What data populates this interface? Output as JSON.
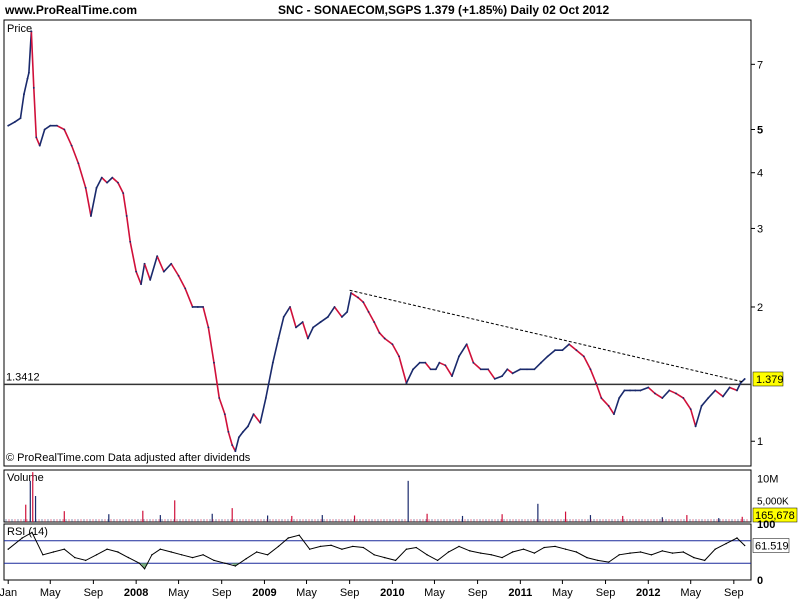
{
  "header": {
    "site": "www.ProRealTime.com",
    "title": "SNC - SONAECOM,SGPS    1.379 (+1.85%)    Daily  02 Oct 2012"
  },
  "chart_data": [
    {
      "type": "line",
      "title": "",
      "ylabel": "Price",
      "scale": "log",
      "ylim": [
        0.88,
        8.8
      ],
      "y_ticks": [
        "1",
        "2",
        "3",
        "4",
        "5",
        "7"
      ],
      "y_ticks_bold": [
        "5"
      ],
      "horizontal_line": {
        "value": 1.3412,
        "label": "1.3412"
      },
      "last_value_label": "1.379",
      "trendline": {
        "from": {
          "date": "2009-09-01",
          "value": 2.18
        },
        "to": {
          "date": "2012-09-25",
          "value": 1.36
        }
      },
      "colors": {
        "up": "#1a2a6c",
        "down": "#d0103a",
        "last_badge": "#ffff00",
        "line": "#000000",
        "trend": "#000000"
      },
      "series": [
        {
          "x": [
            "2007-01-01",
            "2007-01-20",
            "2007-02-05",
            "2007-02-15",
            "2007-02-25",
            "2007-03-01",
            "2007-03-08",
            "2007-03-15",
            "2007-03-22",
            "2007-04-01",
            "2007-04-15",
            "2007-05-01",
            "2007-05-20",
            "2007-06-10",
            "2007-07-01",
            "2007-07-20",
            "2007-08-10",
            "2007-08-25",
            "2007-09-10",
            "2007-09-25",
            "2007-10-10",
            "2007-10-25",
            "2007-11-10",
            "2007-11-25",
            "2007-12-05",
            "2007-12-15",
            "2008-01-01",
            "2008-01-15",
            "2008-01-25",
            "2008-02-10",
            "2008-03-01",
            "2008-03-20",
            "2008-04-10",
            "2008-05-01",
            "2008-05-20",
            "2008-06-10",
            "2008-06-25",
            "2008-07-10",
            "2008-07-25",
            "2008-08-10",
            "2008-08-25",
            "2008-09-10",
            "2008-09-20",
            "2008-10-01",
            "2008-10-10",
            "2008-10-20",
            "2008-11-01",
            "2008-11-15",
            "2008-12-01",
            "2008-12-20",
            "2009-01-05",
            "2009-01-25",
            "2009-02-10",
            "2009-02-25",
            "2009-03-15",
            "2009-04-01",
            "2009-04-20",
            "2009-05-05",
            "2009-05-20",
            "2009-06-10",
            "2009-07-01",
            "2009-07-20",
            "2009-08-10",
            "2009-08-25",
            "2009-09-05",
            "2009-09-25",
            "2009-10-10",
            "2009-10-25",
            "2009-11-10",
            "2009-11-25",
            "2009-12-10",
            "2010-01-01",
            "2010-01-20",
            "2010-02-10",
            "2010-03-01",
            "2010-03-20",
            "2010-04-05",
            "2010-04-20",
            "2010-05-05",
            "2010-05-15",
            "2010-06-01",
            "2010-06-20",
            "2010-07-10",
            "2010-08-01",
            "2010-08-20",
            "2010-09-10",
            "2010-10-01",
            "2010-10-20",
            "2010-11-10",
            "2010-11-25",
            "2010-12-10",
            "2011-01-01",
            "2011-01-20",
            "2011-02-10",
            "2011-03-01",
            "2011-03-20",
            "2011-04-10",
            "2011-05-01",
            "2011-05-20",
            "2011-06-10",
            "2011-07-01",
            "2011-07-20",
            "2011-08-05",
            "2011-08-20",
            "2011-09-10",
            "2011-09-25",
            "2011-10-10",
            "2011-10-25",
            "2011-11-10",
            "2011-11-25",
            "2011-12-10",
            "2012-01-01",
            "2012-01-20",
            "2012-02-10",
            "2012-03-01",
            "2012-03-20",
            "2012-04-10",
            "2012-05-01",
            "2012-05-15",
            "2012-06-01",
            "2012-06-20",
            "2012-07-10",
            "2012-08-01",
            "2012-08-20",
            "2012-09-10",
            "2012-09-20",
            "2012-10-02"
          ],
          "values": [
            5.1,
            5.2,
            5.3,
            6.0,
            6.5,
            6.7,
            8.3,
            6.2,
            4.8,
            4.6,
            5.0,
            5.1,
            5.1,
            5.0,
            4.6,
            4.2,
            3.7,
            3.2,
            3.7,
            3.9,
            3.8,
            3.9,
            3.8,
            3.6,
            3.2,
            2.8,
            2.4,
            2.25,
            2.5,
            2.3,
            2.6,
            2.4,
            2.5,
            2.35,
            2.2,
            2.0,
            2.0,
            2.0,
            1.8,
            1.5,
            1.25,
            1.15,
            1.05,
            0.98,
            0.95,
            1.02,
            1.05,
            1.08,
            1.15,
            1.1,
            1.25,
            1.5,
            1.7,
            1.9,
            2.0,
            1.8,
            1.85,
            1.7,
            1.8,
            1.85,
            1.9,
            2.0,
            1.9,
            1.95,
            2.15,
            2.1,
            2.05,
            1.95,
            1.85,
            1.75,
            1.7,
            1.65,
            1.55,
            1.35,
            1.45,
            1.5,
            1.5,
            1.45,
            1.45,
            1.5,
            1.48,
            1.4,
            1.55,
            1.65,
            1.5,
            1.45,
            1.45,
            1.38,
            1.4,
            1.45,
            1.42,
            1.45,
            1.45,
            1.45,
            1.5,
            1.55,
            1.6,
            1.6,
            1.65,
            1.6,
            1.55,
            1.45,
            1.35,
            1.25,
            1.2,
            1.15,
            1.25,
            1.3,
            1.3,
            1.3,
            1.3,
            1.32,
            1.28,
            1.25,
            1.3,
            1.28,
            1.25,
            1.18,
            1.08,
            1.2,
            1.25,
            1.3,
            1.26,
            1.32,
            1.3,
            1.35,
            1.379
          ]
        }
      ],
      "x_ticks": [
        {
          "date": "2007-01-01",
          "label": "Jan",
          "bold": false
        },
        {
          "date": "2007-05-01",
          "label": "May",
          "bold": false
        },
        {
          "date": "2007-09-01",
          "label": "Sep",
          "bold": false
        },
        {
          "date": "2008-01-01",
          "label": "2008",
          "bold": true
        },
        {
          "date": "2008-05-01",
          "label": "May",
          "bold": false
        },
        {
          "date": "2008-09-01",
          "label": "Sep",
          "bold": false
        },
        {
          "date": "2009-01-01",
          "label": "2009",
          "bold": true
        },
        {
          "date": "2009-05-01",
          "label": "May",
          "bold": false
        },
        {
          "date": "2009-09-01",
          "label": "Sep",
          "bold": false
        },
        {
          "date": "2010-01-01",
          "label": "2010",
          "bold": true
        },
        {
          "date": "2010-05-01",
          "label": "May",
          "bold": false
        },
        {
          "date": "2010-09-01",
          "label": "Sep",
          "bold": false
        },
        {
          "date": "2011-01-01",
          "label": "2011",
          "bold": true
        },
        {
          "date": "2011-05-01",
          "label": "May",
          "bold": false
        },
        {
          "date": "2011-09-01",
          "label": "Sep",
          "bold": false
        },
        {
          "date": "2012-01-01",
          "label": "2012",
          "bold": true
        },
        {
          "date": "2012-05-01",
          "label": "May",
          "bold": false
        },
        {
          "date": "2012-09-01",
          "label": "Sep",
          "bold": false
        }
      ],
      "x_range": [
        "2006-12-20",
        "2012-10-20"
      ],
      "footnote": "© ProRealTime.com  Data adjusted after dividends"
    },
    {
      "type": "bar",
      "ylabel": "Volume",
      "y_ticks": [
        "10M",
        "5,000K"
      ],
      "ylim": [
        0,
        12000000
      ],
      "last_value_label": "165,678",
      "series": [
        {
          "x": [
            "2007-02-20",
            "2007-03-05",
            "2007-03-12",
            "2007-03-20",
            "2007-06-10",
            "2007-10-15",
            "2008-01-20",
            "2008-03-10",
            "2008-04-20",
            "2008-08-05",
            "2008-10-01",
            "2009-01-10",
            "2009-03-20",
            "2009-06-15",
            "2009-09-15",
            "2010-02-15",
            "2010-04-10",
            "2010-07-20",
            "2010-11-10",
            "2011-02-20",
            "2011-05-10",
            "2011-07-20",
            "2011-10-20",
            "2012-02-10",
            "2012-04-20",
            "2012-07-20",
            "2012-09-25"
          ],
          "values": [
            4000000,
            9500000,
            11500000,
            6000000,
            2500000,
            1800000,
            2600000,
            1600000,
            5000000,
            1900000,
            3200000,
            1500000,
            1400000,
            1600000,
            1500000,
            9500000,
            1900000,
            1400000,
            1800000,
            4200000,
            2400000,
            1600000,
            1400000,
            1100000,
            1600000,
            900000,
            1200000
          ]
        }
      ],
      "colors": {
        "up": "#1a2a6c",
        "down": "#d0103a",
        "last_badge": "#ffff00"
      }
    },
    {
      "type": "line",
      "ylabel": "RSI (14)",
      "ylim": [
        0,
        100
      ],
      "y_ticks": [
        "100",
        "0"
      ],
      "bands": [
        30,
        70
      ],
      "last_value_label": "61.519",
      "series": [
        {
          "x": [
            "2007-01-01",
            "2007-02-10",
            "2007-03-10",
            "2007-04-10",
            "2007-05-10",
            "2007-06-10",
            "2007-07-10",
            "2007-08-10",
            "2007-09-10",
            "2007-10-10",
            "2007-11-10",
            "2007-12-10",
            "2008-01-10",
            "2008-01-25",
            "2008-02-15",
            "2008-03-10",
            "2008-04-10",
            "2008-05-10",
            "2008-06-10",
            "2008-07-10",
            "2008-08-10",
            "2008-09-10",
            "2008-10-10",
            "2008-11-10",
            "2008-12-10",
            "2009-01-10",
            "2009-02-10",
            "2009-03-10",
            "2009-04-10",
            "2009-05-10",
            "2009-06-10",
            "2009-07-10",
            "2009-08-10",
            "2009-09-10",
            "2009-10-10",
            "2009-11-10",
            "2009-12-10",
            "2010-01-10",
            "2010-02-10",
            "2010-03-10",
            "2010-04-10",
            "2010-05-10",
            "2010-06-10",
            "2010-07-10",
            "2010-08-10",
            "2010-09-10",
            "2010-10-10",
            "2010-11-10",
            "2010-12-10",
            "2011-01-10",
            "2011-02-10",
            "2011-03-10",
            "2011-04-10",
            "2011-05-10",
            "2011-06-10",
            "2011-07-10",
            "2011-08-10",
            "2011-09-10",
            "2011-10-10",
            "2011-11-10",
            "2011-12-10",
            "2012-01-10",
            "2012-02-10",
            "2012-03-10",
            "2012-04-10",
            "2012-05-10",
            "2012-06-10",
            "2012-07-10",
            "2012-08-10",
            "2012-09-10",
            "2012-10-02"
          ],
          "values": [
            55,
            75,
            85,
            45,
            50,
            55,
            40,
            35,
            45,
            55,
            50,
            40,
            30,
            20,
            45,
            55,
            50,
            45,
            40,
            45,
            35,
            30,
            25,
            38,
            50,
            45,
            60,
            75,
            80,
            55,
            60,
            62,
            55,
            60,
            58,
            45,
            40,
            35,
            55,
            58,
            45,
            35,
            50,
            60,
            52,
            48,
            45,
            40,
            50,
            55,
            48,
            58,
            60,
            55,
            50,
            40,
            35,
            32,
            45,
            48,
            50,
            45,
            52,
            48,
            50,
            40,
            35,
            55,
            65,
            75,
            61.519
          ]
        }
      ],
      "colors": {
        "line": "#000000",
        "band": "#1a2a9c",
        "oversold_fill": "#60a060",
        "last_badge": "#ffffff"
      }
    }
  ]
}
